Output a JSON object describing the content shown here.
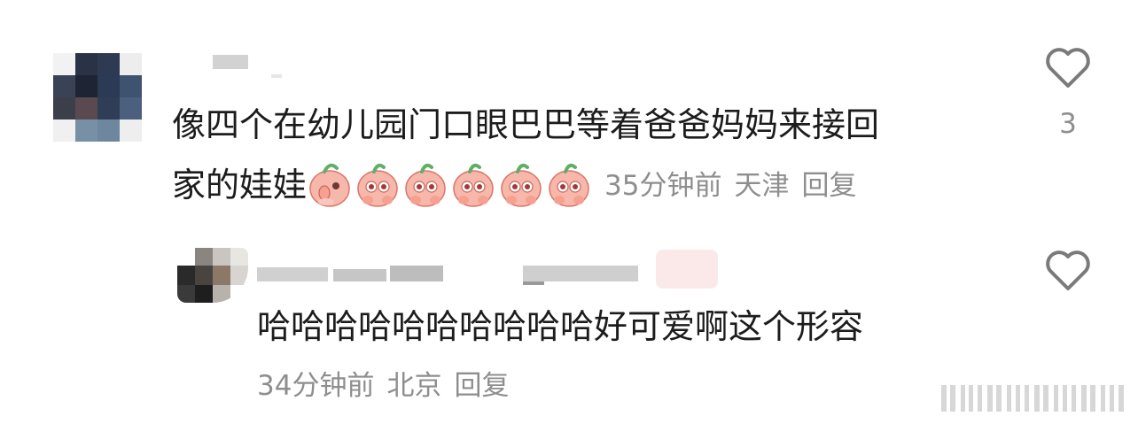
{
  "comment": {
    "text_line1": "像四个在幼儿园门口眼巴巴等着爸爸妈妈来接回",
    "text_line2": "家的娃娃",
    "time": "35分钟前",
    "location": "天津",
    "reply_label": "回复",
    "like_count": "3",
    "emoji_count": 6,
    "emoji_icon": "peach-doll-emoji"
  },
  "reply": {
    "text": "哈哈哈哈哈哈哈哈哈哈好可爱啊这个形容",
    "time": "34分钟前",
    "location": "北京",
    "reply_label": "回复"
  },
  "icons": {
    "like": "heart-outline-icon",
    "watermark": "striped-watermark"
  },
  "colors": {
    "text": "#1c1c1c",
    "meta": "#8e8e8e",
    "icon": "#7a7a7a"
  }
}
